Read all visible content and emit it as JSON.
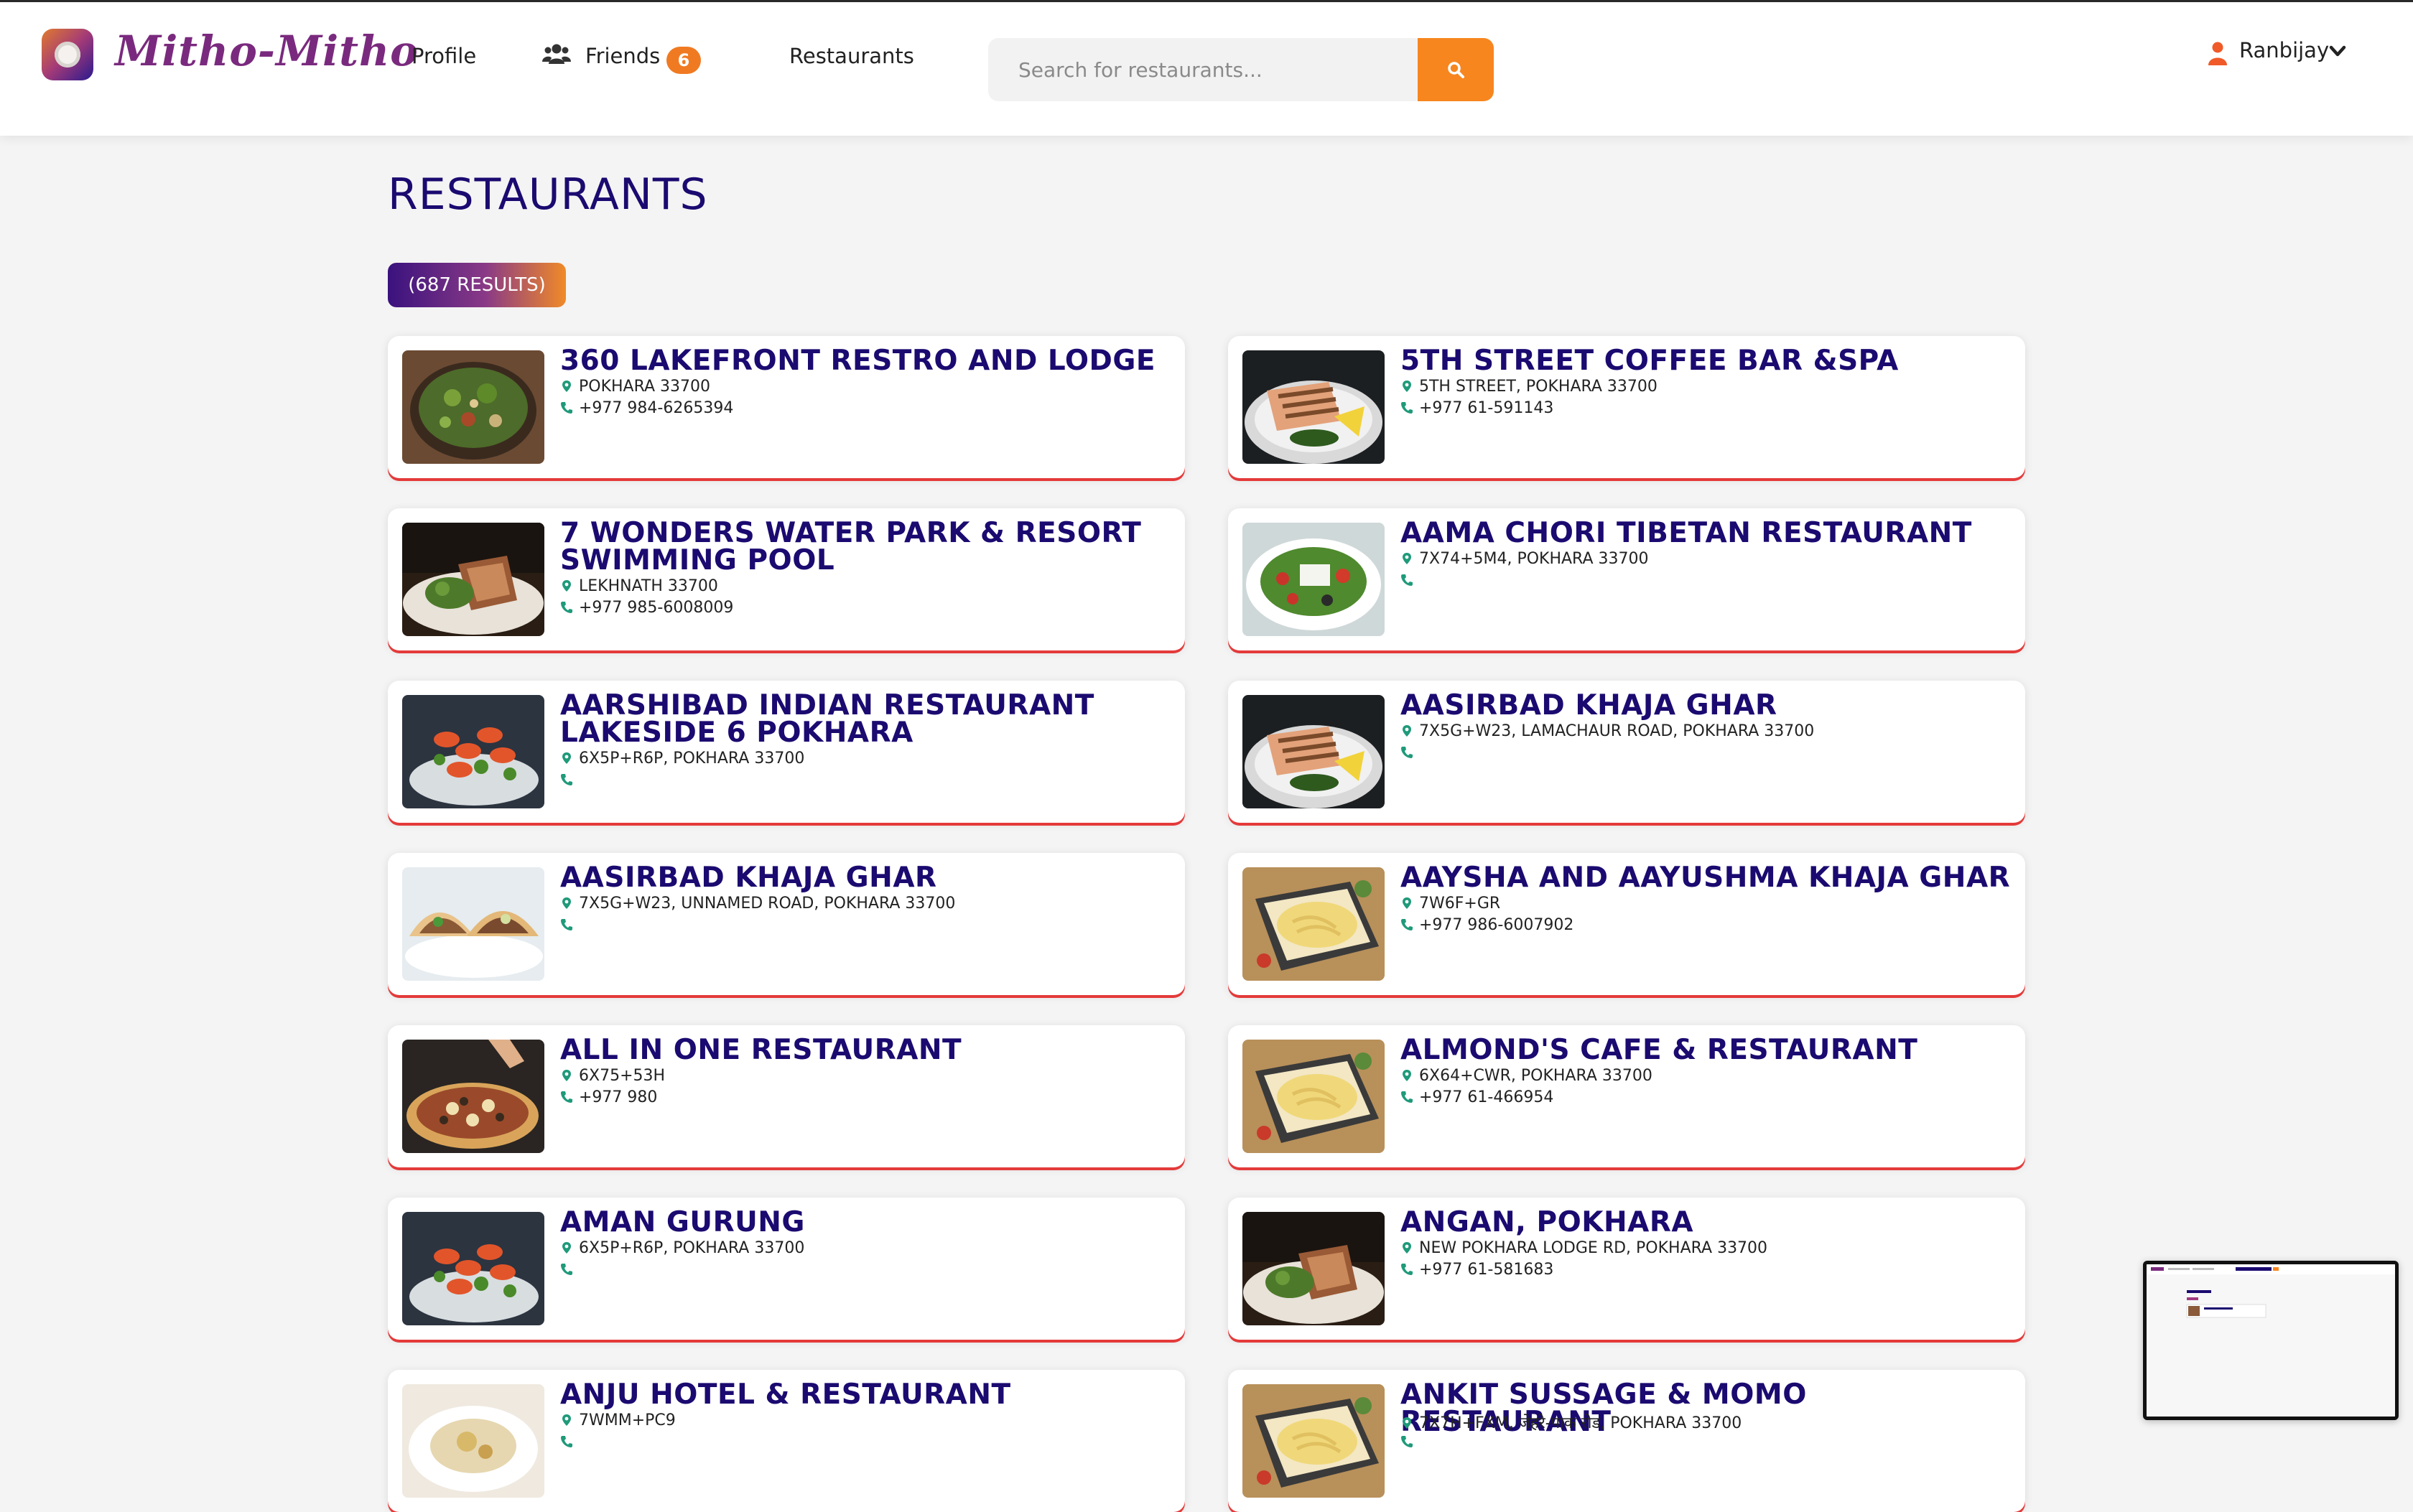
{
  "app": {
    "logo_text": "Mitho-Mitho",
    "accent_color": "#f7861f",
    "brand_color": "#1b0a70",
    "underline_color": "#e43a3a"
  },
  "nav": {
    "profile": "Profile",
    "friends": "Friends",
    "friends_count": "6",
    "restaurants": "Restaurants",
    "search_placeholder": "Search for restaurants...",
    "user_name": "Ranbijay"
  },
  "page": {
    "title": "RESTAURANTS",
    "results": "(687 RESULTS)"
  },
  "restaurants": [
    {
      "name": "360 LAKEFRONT RESTRO AND LODGE",
      "address": "POKHARA 33700",
      "phone": "+977 984-6265394",
      "image": "salad-bowl"
    },
    {
      "name": "5TH STREET COFFEE BAR &SPA",
      "address": "5TH STREET, POKHARA 33700",
      "phone": "+977 61-591143",
      "image": "grilled-salmon"
    },
    {
      "name": "7 WONDERS WATER PARK & RESORT SWIMMING POOL",
      "address": "LEKHNATH 33700",
      "phone": "+977 985-6008009",
      "image": "steak-plate"
    },
    {
      "name": "AAMA CHORI TIBETAN RESTAURANT",
      "address": "7X74+5M4, POKHARA 33700",
      "phone": "",
      "image": "greek-salad"
    },
    {
      "name": "AARSHIBAD INDIAN RESTAURANT LAKESIDE 6 POKHARA",
      "address": "6X5P+R6P, POKHARA 33700",
      "phone": "",
      "image": "shrimp-skewers"
    },
    {
      "name": "AASIRBAD KHAJA GHAR",
      "address": "7X5G+W23, LAMACHAUR ROAD, POKHARA 33700",
      "phone": "",
      "image": "grilled-salmon"
    },
    {
      "name": "AASIRBAD KHAJA GHAR",
      "address": "7X5G+W23, UNNAMED ROAD, POKHARA 33700",
      "phone": "",
      "image": "tacos"
    },
    {
      "name": "AAYSHA AND AAYUSHMA KHAJA GHAR",
      "address": "7W6F+GR",
      "phone": "+977 986-6007902",
      "image": "pasta-dish"
    },
    {
      "name": "ALL IN ONE RESTAURANT",
      "address": "6X75+53H",
      "phone": "+977 980",
      "image": "pizza"
    },
    {
      "name": "ALMOND'S CAFE & RESTAURANT",
      "address": "6X64+CWR, POKHARA 33700",
      "phone": "+977 61-466954",
      "image": "pasta-dish"
    },
    {
      "name": "AMAN GURUNG",
      "address": "6X5P+R6P, POKHARA 33700",
      "phone": "",
      "image": "shrimp-skewers"
    },
    {
      "name": "ANGAN, POKHARA",
      "address": "NEW POKHARA LODGE RD, POKHARA 33700",
      "phone": "+977 61-581683",
      "image": "steak-plate"
    },
    {
      "name": "ANJU HOTEL & RESTAURANT",
      "address": "7WMM+PC9",
      "phone": "",
      "image": "dish"
    },
    {
      "name": "ANKIT SUSSAGE & MOMO RESTAURANT",
      "address": "7X7H+FXM, जेहरे-पाक रोड, POKHARA 33700",
      "phone": "",
      "image": "pasta-dish"
    }
  ]
}
